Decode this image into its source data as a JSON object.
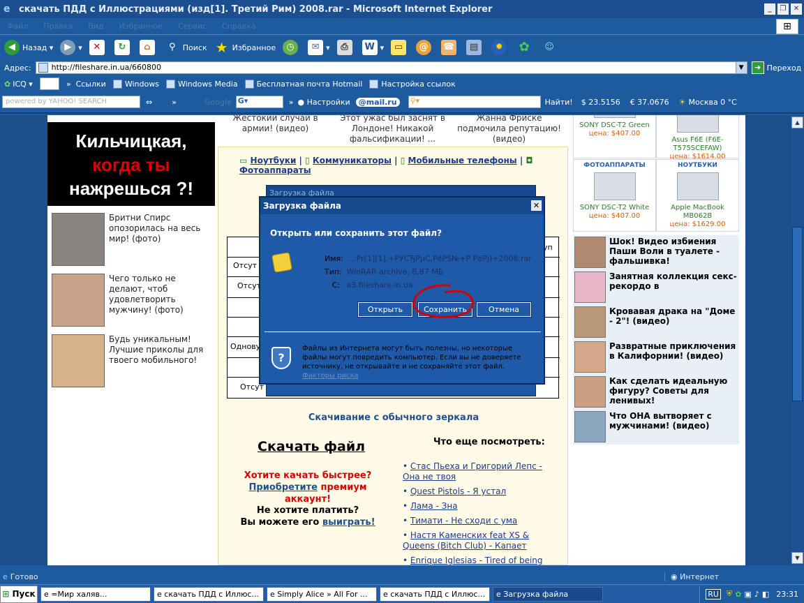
{
  "window": {
    "title": "скачать ПДД с Иллюстрациями (изд[1]. Третий Рим) 2008.rar - Microsoft Internet Explorer"
  },
  "menu": [
    "Файл",
    "Правка",
    "Вид",
    "Избранное",
    "Сервис",
    "Справка"
  ],
  "toolbar": {
    "back": "Назад",
    "search": "Поиск",
    "favorites": "Избранное"
  },
  "address": {
    "label": "Адрес:",
    "url": "http://fileshare.in.ua/660800",
    "go": "Переход"
  },
  "links": {
    "icq": "ICQ",
    "links_label": "Ссылки",
    "items": [
      "Windows",
      "Windows Media",
      "Бесплатная почта Hotmail",
      "Настройка ссылок"
    ]
  },
  "searchbar": {
    "yahoo_placeholder": "powered by YAHOO! SEARCH",
    "google": "Google",
    "settings": "Настройки",
    "mail": "@mail.ru",
    "find": "Найти!",
    "usd": "$ 23.5156",
    "eur": "€ 37.0676",
    "weather": "Москва 0 °C"
  },
  "page": {
    "banner": {
      "l1": "Кильчицкая,",
      "l2": "когда ты",
      "l3": "нажрешься ?!"
    },
    "left_news": [
      "Бритни Спирс опозорилась на весь мир! (фото)",
      "Чего только не делают, чтоб удовлетворить мужчину! (фото)",
      "Будь уникальным! Лучшие приколы для твоего мобильного!"
    ],
    "top_texts": [
      "Жестокий случай в армии! (видео)",
      "Этот ужас был заснят в Лондоне! Никакой фальсификации! ...",
      "Жанна Фриске подмочила репутацию! (видео)"
    ],
    "categories": [
      "Ноутбуки",
      "Коммуникаторы",
      "Мобильные телефоны",
      "Фотоаппараты"
    ],
    "table_cells": [
      "Отсут",
      "Отсут",
      "Однову",
      "Отсут",
      "уп"
    ],
    "mirror": "Скачивание с обычного зеркала",
    "download": "Скачать файл",
    "faster_q": "Хотите качать быстрее?",
    "faster_link": "Приобретите",
    "faster_rest": "премиум аккаунт!",
    "notpay_q": "Не хотите платить?",
    "notpay_text": "Вы можете его",
    "notpay_link": "выиграть!",
    "what_title": "Что еще посмотреть:",
    "what_list": [
      "Стас Пьеха и Григорий Лепс - Она не твоя",
      "Quest Pistols - Я устал",
      "Лама - Зна",
      "Тимати - Не сходи с ума",
      "Настя Каменских feat XS & Queens (Bitch Club) - Капает",
      "Enrique Iglesias - Tired of being sorry"
    ],
    "products": [
      {
        "cat": "",
        "name": "SONY DSC-T2 Green",
        "price": "цена: $407.00"
      },
      {
        "cat": "",
        "name": "Asus F6E (F6E-T575SCEFAW)",
        "price": "цена: $1614.00"
      },
      {
        "cat": "ФОТОАППАРАТЫ",
        "name": "SONY DSC-T2 White",
        "price": "цена: $407.00"
      },
      {
        "cat": "НОУТБУКИ",
        "name": "Apple MacBook MB062B",
        "price": "цена: $1629.00"
      }
    ],
    "right_news": [
      "Шок! Видео избиения Паши Воли в туалете - фальшивка!",
      "Занятная коллекция секс-рекордо в",
      "Кровавая драка на \"Доме - 2\"! (видео)",
      "Развратные приключения в Калифорнии! (видео)",
      "Как сделать идеальную фигуру? Советы для ленивых!",
      "Что ОНА вытворяет с мужчинами! (видео)"
    ]
  },
  "bg_dialog_title": "Загрузка файла",
  "dialog": {
    "title": "Загрузка файла",
    "close": "✕",
    "question": "Открыть или сохранить этот файл?",
    "name_label": "Имя:",
    "name_value": "...:Pr[1][1].+РУСЂРµС,РёРЅ№+Р РёРј)+2008.rar",
    "type_label": "Тип:",
    "type_value": "WinRAR archive, 8,87 МБ",
    "from_label": "С:",
    "from_value": "a3.fileshare.in.ua",
    "open": "Открыть",
    "save": "Сохранить",
    "cancel": "Отмена",
    "warning": "Файлы из Интернета могут быть полезны, но некоторые файлы могут повредить компьютер. Если вы не доверяете источнику, не открывайте и не сохраняйте этот файл.",
    "risk_link": "Факторы риска"
  },
  "status": {
    "left": "Готово",
    "zone": "Интернет"
  },
  "taskbar": {
    "start": "Пуск",
    "tasks": [
      "=Мир халяв...",
      "скачать ПДД с Иллюс...",
      "Simply Alice » All For ...",
      "скачать ПДД с Иллюс...",
      "Загрузка файла"
    ],
    "lang": "RU",
    "clock": "23:31"
  },
  "colors": {
    "accent": "#1f5aa8",
    "annotation": "#d40000"
  }
}
